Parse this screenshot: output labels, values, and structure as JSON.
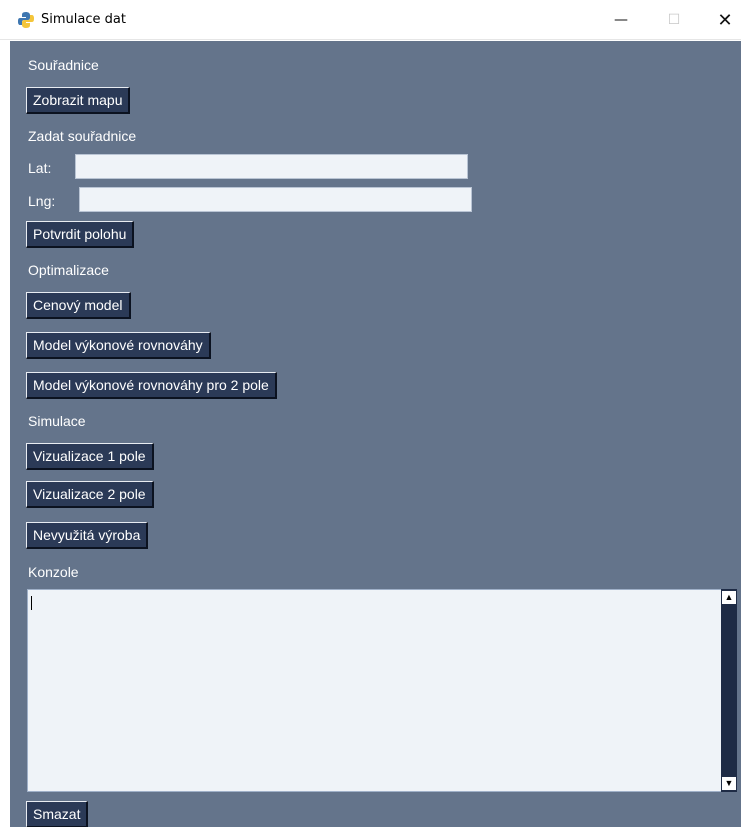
{
  "window": {
    "title": "Simulace dat",
    "minimize_glyph": "—",
    "maximize_glyph": "☐",
    "close_glyph": "✕",
    "app_icon": "python-icon"
  },
  "sections": {
    "coordinates": "Souřadnice",
    "enter_coordinates": "Zadat souřadnice",
    "optimization": "Optimalizace",
    "simulation": "Simulace",
    "console": "Konzole"
  },
  "fields": {
    "lat_label": "Lat:",
    "lat_value": "",
    "lng_label": "Lng:",
    "lng_value": ""
  },
  "buttons": {
    "show_map": "Zobrazit mapu",
    "confirm_position": "Potvrdit polohu",
    "price_model": "Cenový model",
    "power_balance_model": "Model výkonové rovnováhy",
    "power_balance_model_2": "Model výkonové rovnováhy pro 2 pole",
    "visualize_1": "Vizualizace 1 pole",
    "visualize_2": "Vizualizace 2 pole",
    "unused_production": "Nevyužitá výroba",
    "clear": "Smazat"
  },
  "console": {
    "text": ""
  },
  "colors": {
    "background": "#64748b",
    "button": "#2b3a57",
    "entry": "#eff3f8",
    "scrollbar": "#1e2b45"
  }
}
